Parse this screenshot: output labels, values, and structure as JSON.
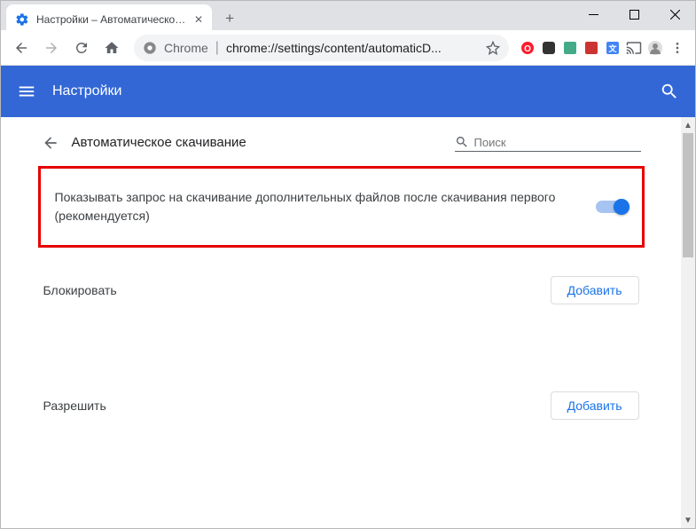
{
  "window": {
    "tab_title": "Настройки – Автоматическое с"
  },
  "toolbar": {
    "url_prefix": "Chrome",
    "url_path": "chrome://settings/content/automaticD..."
  },
  "bluebar": {
    "title": "Настройки"
  },
  "page": {
    "back_title": "Автоматическое скачивание",
    "search_placeholder": "Поиск",
    "toggle_row": "Показывать запрос на скачивание дополнительных файлов после скачивания первого (рекомендуется)",
    "block_label": "Блокировать",
    "allow_label": "Разрешить",
    "add_button": "Добавить"
  }
}
